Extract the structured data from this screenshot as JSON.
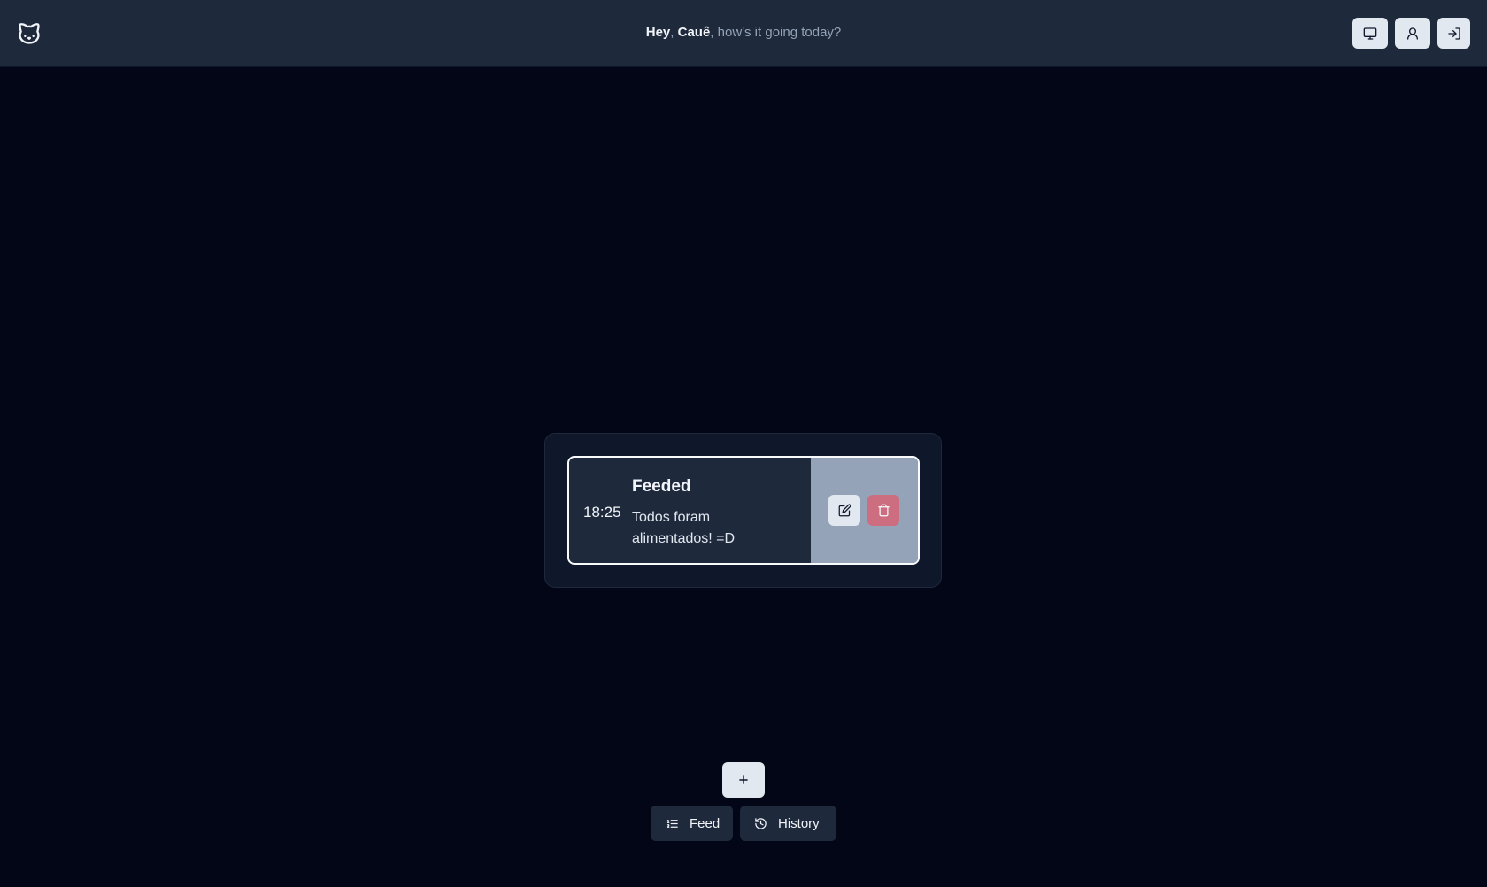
{
  "header": {
    "greeting": {
      "hey": "Hey",
      "comma1": ",",
      "name": "Cauê",
      "rest": ", how's it going today?"
    },
    "logo_icon": "cat-face-icon",
    "buttons": [
      {
        "icon": "monitor-icon",
        "label": ""
      },
      {
        "icon": "user-icon",
        "label": ""
      },
      {
        "icon": "log-in-icon",
        "label": ""
      }
    ]
  },
  "entry": {
    "time": "18:25",
    "title": "Feeded",
    "description": "Todos foram alimentados! =D",
    "edit_icon": "edit-icon",
    "delete_icon": "trash-icon"
  },
  "actions": {
    "add_icon": "plus-icon"
  },
  "nav": {
    "feed_label": "Feed",
    "feed_icon": "list-ordered-icon",
    "history_label": "History",
    "history_icon": "history-icon"
  },
  "colors": {
    "background": "#020617",
    "header": "#1e293b",
    "panel": "#0f172a",
    "card": "#1e293b",
    "card_actions": "#94a3b8",
    "delete": "#cc6e7f",
    "button_light": "#e2e8f0"
  }
}
